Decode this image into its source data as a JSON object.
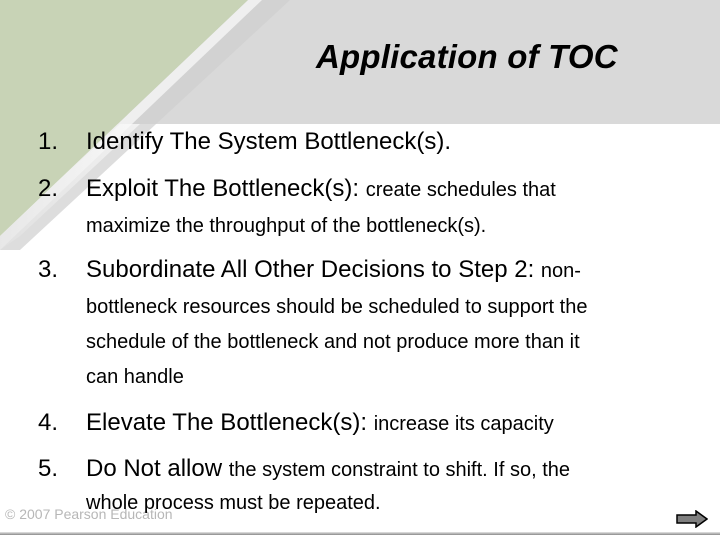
{
  "slide": {
    "title": "Application of TOC",
    "colors": {
      "header_band": "#d9d9d9",
      "accent_triangle": "#c8d3b6",
      "background": "#ffffff",
      "footer_text": "#b7b7b7"
    },
    "items": [
      {
        "number": "1.",
        "lead": "Identify The System Bottleneck(s).",
        "rest": "",
        "continuation": []
      },
      {
        "number": "2.",
        "lead": "Exploit The Bottleneck(s): ",
        "rest": "create schedules that",
        "continuation": [
          "maximize the throughput of the bottleneck(s)."
        ]
      },
      {
        "number": "3.",
        "lead": "Subordinate All Other Decisions to Step 2: ",
        "rest": "non-",
        "continuation": [
          "bottleneck resources should be scheduled to support the",
          "schedule of the bottleneck and not produce more than it",
          "can handle"
        ]
      },
      {
        "number": "4.",
        "lead": "Elevate The Bottleneck(s): ",
        "rest": "increase its capacity",
        "continuation": []
      },
      {
        "number": "5.",
        "lead": "Do Not allow ",
        "rest": "the system constraint to shift. If so, the",
        "continuation": [
          "whole process must be repeated."
        ]
      }
    ],
    "footer": {
      "copyright": "© 2007 Pearson Education",
      "next_icon": "right-arrow-icon"
    }
  }
}
